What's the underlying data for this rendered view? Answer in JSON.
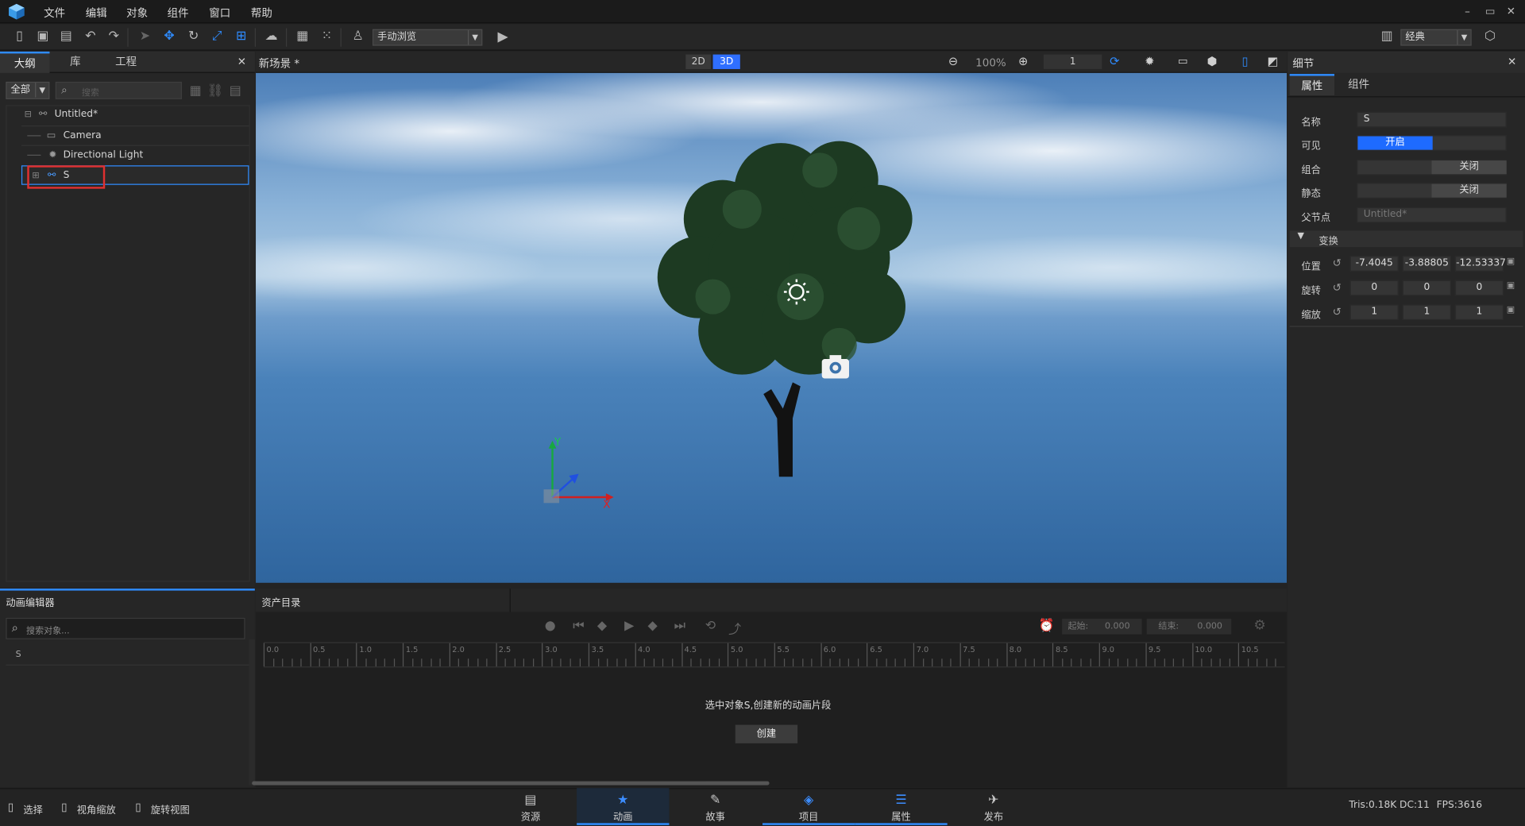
{
  "menu": {
    "file": "文件",
    "edit": "编辑",
    "object": "对象",
    "component": "组件",
    "window": "窗口",
    "help": "帮助"
  },
  "toolbar": {
    "browse_mode": "手动浏览",
    "layout": "经典"
  },
  "left_panel": {
    "tabs": [
      "大纲",
      "库",
      "工程"
    ],
    "filter": "全部",
    "search_placeholder": "搜索",
    "tree": [
      {
        "label": "Untitled*"
      },
      {
        "label": "Camera"
      },
      {
        "label": "Directional Light"
      },
      {
        "label": "S"
      }
    ]
  },
  "scene": {
    "title": "新场景 *",
    "btn_2d": "2D",
    "btn_3d": "3D",
    "zoom": "100%",
    "page": "1",
    "gizmo_x": "X",
    "gizmo_y": "Y"
  },
  "details": {
    "title": "细节",
    "tabs": [
      "属性",
      "组件"
    ],
    "name_label": "名称",
    "name_value": "S",
    "visible_label": "可见",
    "visible_value": "开启",
    "group_label": "组合",
    "group_value": "关闭",
    "static_label": "静态",
    "static_value": "关闭",
    "parent_label": "父节点",
    "parent_value": "Untitled*",
    "transform_label": "变换",
    "position_label": "位置",
    "position": [
      "-7.4045",
      "-3.88805",
      "-12.53337"
    ],
    "rotation_label": "旋转",
    "rotation": [
      "0",
      "0",
      "0"
    ],
    "scale_label": "缩放",
    "scale": [
      "1",
      "1",
      "1"
    ]
  },
  "anim": {
    "title": "动画编辑器",
    "asset_tab": "资产目录",
    "search_placeholder": "搜索对象...",
    "object": "S",
    "start_label": "起始:",
    "start_value": "0.000",
    "end_label": "结束:",
    "end_value": "0.000",
    "message": "选中对象S,创建新的动画片段",
    "create": "创建",
    "ruler": [
      "0.0",
      "0.5",
      "1.0",
      "1.5",
      "2.0",
      "2.5",
      "3.0",
      "3.5",
      "4.0",
      "4.5",
      "5.0",
      "5.5",
      "6.0",
      "6.5",
      "7.0",
      "7.5",
      "8.0",
      "8.5",
      "9.0",
      "9.5",
      "10.0",
      "10.5"
    ]
  },
  "statusbar": {
    "select": "选择",
    "zoom_view": "视角缩放",
    "rotate_view": "旋转视图",
    "tabs": [
      {
        "label": "资源",
        "icon": "resource-icon"
      },
      {
        "label": "动画",
        "icon": "animation-icon"
      },
      {
        "label": "故事",
        "icon": "story-icon"
      },
      {
        "label": "项目",
        "icon": "project-icon"
      },
      {
        "label": "属性",
        "icon": "properties-icon"
      },
      {
        "label": "发布",
        "icon": "publish-icon"
      }
    ],
    "tris": "Tris:0.18K",
    "dc": "DC:11",
    "fps": "FPS:3616"
  },
  "colors": {
    "accent": "#2f8cff",
    "highlight": "#e03030",
    "bg": "#232323"
  }
}
